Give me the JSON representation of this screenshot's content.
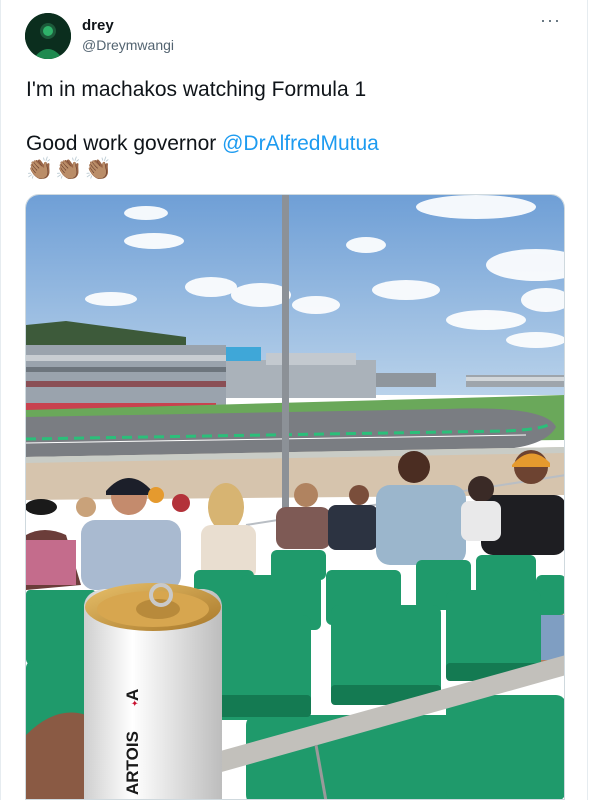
{
  "user": {
    "display_name": "drey",
    "handle": "@Dreymwangi"
  },
  "menu": {
    "more_label": "···"
  },
  "tweet": {
    "line1": "I'm in machakos watching Formula 1",
    "line2_prefix": "Good work governor ",
    "mention": "@DrAlfredMutua",
    "emojis": "👏🏽👏🏽👏🏽"
  },
  "photo": {
    "can_brand": "ARTOIS",
    "can_brand_alt": "A"
  },
  "colors": {
    "link": "#1d9bf0",
    "text": "#0f1419",
    "muted": "#536471",
    "seat_green": "#1f9a6b"
  }
}
